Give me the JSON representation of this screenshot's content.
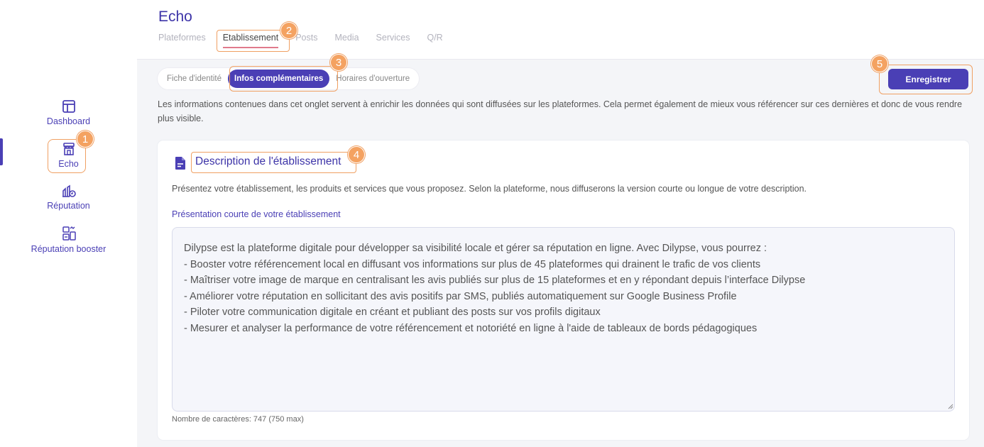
{
  "sidebar": {
    "items": [
      {
        "label": "Dashboard",
        "icon": "dashboard-icon"
      },
      {
        "label": "Echo",
        "icon": "store-icon"
      },
      {
        "label": "Réputation",
        "icon": "reputation-icon"
      },
      {
        "label": "Réputation booster",
        "icon": "booster-icon"
      }
    ]
  },
  "header": {
    "title": "Echo",
    "tabs": [
      "Plateformes",
      "Etablissement",
      "Posts",
      "Media",
      "Services",
      "Q/R"
    ]
  },
  "subtabs": [
    "Fiche d'identité",
    "Infos complémentaires",
    "Horaires d'ouverture"
  ],
  "save_label": "Enregistrer",
  "info_text": "Les informations contenues dans cet onglet servent à enrichir les données qui sont diffusées sur les plateformes. Cela permet également de mieux vous référencer sur ces dernières et donc de vous rendre plus visible.",
  "card": {
    "title": "Description de l'établissement",
    "description": "Présentez votre établissement, les produits et services que vous proposez. Selon la plateforme, nous diffuserons la version courte ou longue de votre description.",
    "field_label": "Présentation courte de votre établissement",
    "field_value": "Dilypse est la plateforme digitale pour développer sa visibilité locale et gérer sa réputation en ligne. Avec Dilypse, vous pourrez :\n- Booster votre référencement local en diffusant vos informations sur plus de 45 plateformes qui drainent le trafic de vos clients\n- Maîtriser votre image de marque en centralisant les avis publiés sur plus de 15 plateformes et en y répondant depuis l’interface Dilypse\n- Améliorer votre réputation en sollicitant des avis positifs par SMS, publiés automatiquement sur Google Business Profile\n- Piloter votre communication digitale en créant et publiant des posts sur vos profils digitaux\n- Mesurer et analyser la performance de votre référencement et notoriété en ligne à l'aide de tableaux de bords pédagogiques",
    "char_count": "Nombre de caractères: 747 (750 max)"
  },
  "callouts": [
    "1",
    "2",
    "3",
    "4",
    "5"
  ],
  "colors": {
    "accent": "#4a3fb5",
    "callout": "#f4a261",
    "tab_underline": "#e07a8c"
  }
}
